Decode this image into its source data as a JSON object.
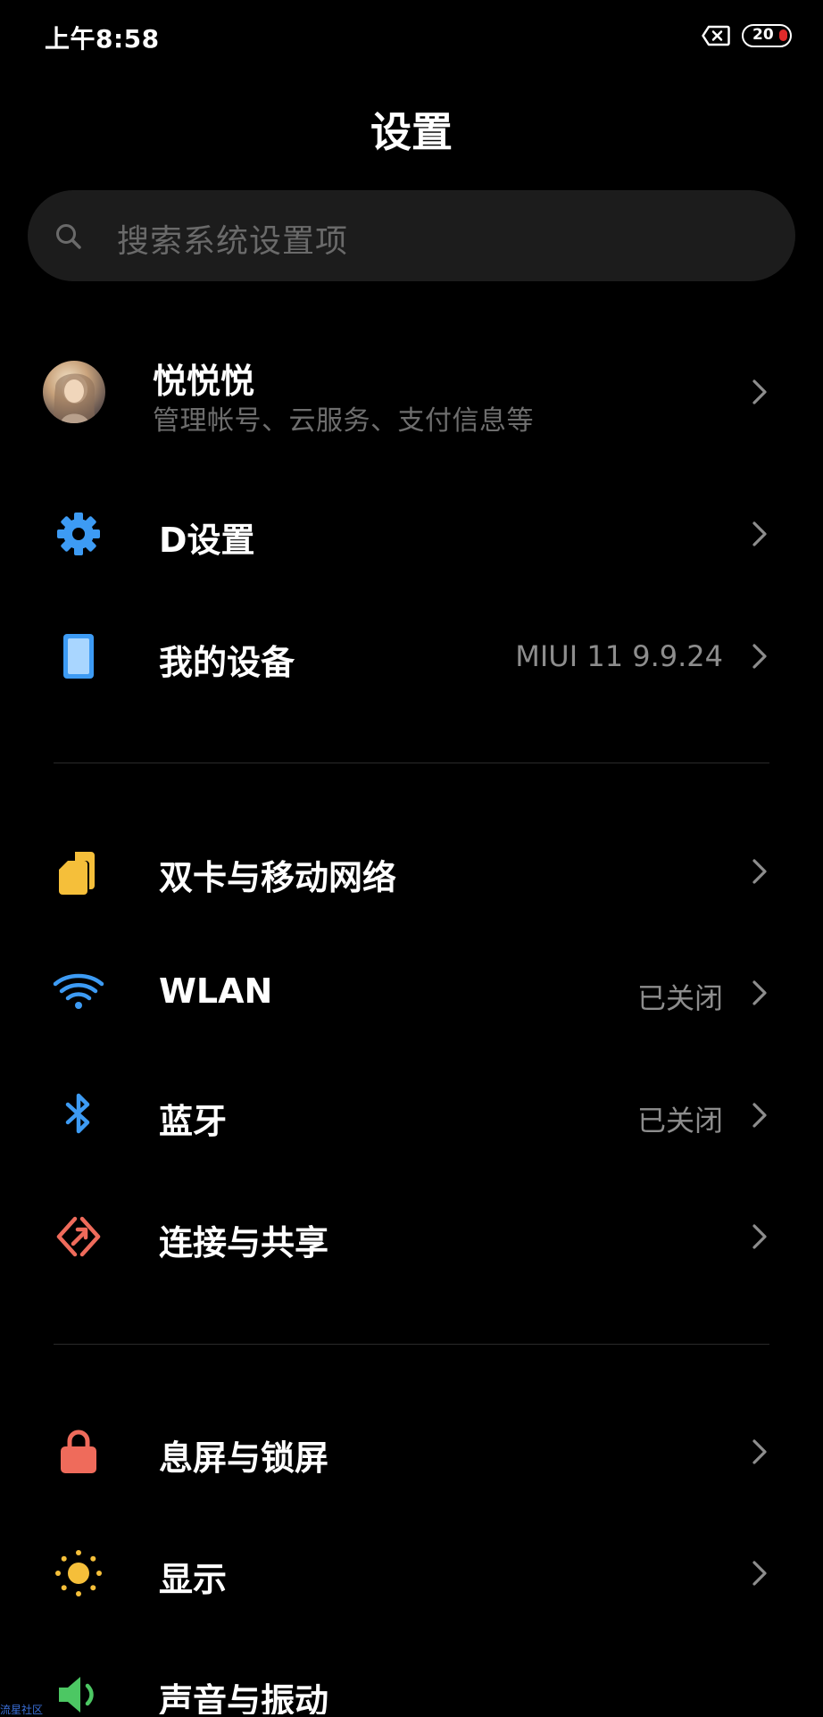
{
  "status_bar": {
    "time": "上午8:58",
    "battery_level": "20",
    "colors": {
      "battery_low": "#e12a2a"
    }
  },
  "header": {
    "title": "设置"
  },
  "search": {
    "placeholder": "搜索系统设置项",
    "icon": "search-icon"
  },
  "account": {
    "name": "悦悦悦",
    "subtitle": "管理帐号、云服务、支付信息等"
  },
  "groups": [
    {
      "items": [
        {
          "label": "D设置",
          "icon": "gear-icon",
          "value": ""
        },
        {
          "label": "我的设备",
          "icon": "tablet-icon",
          "value": "MIUI 11 9.9.24"
        }
      ]
    },
    {
      "items": [
        {
          "label": "双卡与移动网络",
          "icon": "sim-card-icon",
          "value": ""
        },
        {
          "label": "WLAN",
          "icon": "wifi-icon",
          "value": "已关闭"
        },
        {
          "label": "蓝牙",
          "icon": "bluetooth-icon",
          "value": "已关闭"
        },
        {
          "label": "连接与共享",
          "icon": "share-icon",
          "value": ""
        }
      ]
    },
    {
      "items": [
        {
          "label": "息屏与锁屏",
          "icon": "lock-icon",
          "value": ""
        },
        {
          "label": "显示",
          "icon": "sun-icon",
          "value": ""
        },
        {
          "label": "声音与振动",
          "icon": "speaker-icon",
          "value": ""
        }
      ]
    }
  ],
  "watermark": "流星社区",
  "colors": {
    "background": "#000000",
    "search_bg": "#1c1c1c",
    "icon_blue": "#3d9bf4",
    "icon_yellow": "#f5bf3a",
    "icon_red": "#ef6b5b"
  }
}
